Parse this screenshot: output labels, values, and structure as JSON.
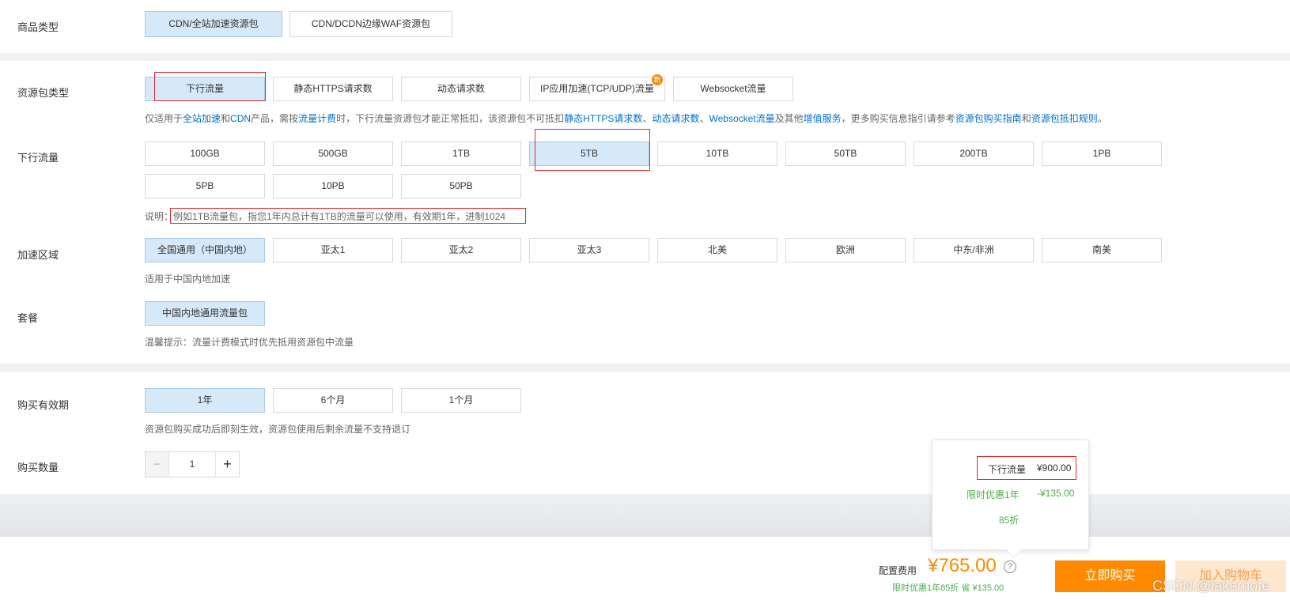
{
  "product_type": {
    "label": "商品类型",
    "options": [
      "CDN/全站加速资源包",
      "CDN/DCDN边缘WAF资源包"
    ]
  },
  "package_type": {
    "label": "资源包类型",
    "options": [
      "下行流量",
      "静态HTTPS请求数",
      "动态请求数",
      "IP应用加速(TCP/UDP)流量",
      "Websocket流量"
    ],
    "new_badge": "新",
    "hint": {
      "p1": "仅适用于",
      "l1": "全站加速",
      "p2": "和",
      "l2": "CDN",
      "p3": "产品，需按",
      "l3": "流量计费",
      "p4": "时，下行流量资源包才能正常抵扣，该资源包不可抵扣",
      "l4": "静态HTTPS请求数",
      "p5": "、",
      "l5": "动态请求数",
      "p6": "、",
      "l6": "Websocket流量",
      "p7": "及其他",
      "l7": "增值服务",
      "p8": "，更多购买信息指引请参考",
      "l8": "资源包购买指南",
      "p9": "和",
      "l9": "资源包抵扣规则",
      "p10": "。"
    }
  },
  "traffic": {
    "label": "下行流量",
    "options": [
      "100GB",
      "500GB",
      "1TB",
      "5TB",
      "10TB",
      "50TB",
      "200TB",
      "1PB",
      "5PB",
      "10PB",
      "50PB"
    ],
    "note_prefix": "说明：",
    "note": "例如1TB流量包，指您1年内总计有1TB的流量可以使用，有效期1年，进制1024"
  },
  "region": {
    "label": "加速区域",
    "options": [
      "全国通用（中国内地）",
      "亚太1",
      "亚太2",
      "亚太3",
      "北美",
      "欧洲",
      "中东/非洲",
      "南美"
    ],
    "hint": "适用于中国内地加速"
  },
  "plan": {
    "label": "套餐",
    "options": [
      "中国内地通用流量包"
    ],
    "hint": "温馨提示：流量计费模式时优先抵用资源包中流量"
  },
  "validity": {
    "label": "购买有效期",
    "options": [
      "1年",
      "6个月",
      "1个月"
    ],
    "hint": "资源包购买成功后即刻生效，资源包使用后剩余流量不支持退订"
  },
  "quantity": {
    "label": "购买数量",
    "minus": "−",
    "value": "1",
    "plus": "+"
  },
  "popover": {
    "item_label": "下行流量",
    "item_price": "¥900.00",
    "discount_label": "限时优惠1年",
    "discount_value": "-¥135.00",
    "discount_rate": "85折"
  },
  "footer": {
    "fee_label": "配置费用",
    "price": "¥765.00",
    "help_icon": "?",
    "discount_note": "限时优惠1年85折 省 ¥135.00",
    "buy_button": "立即购买",
    "cart_button": "加入购物车"
  },
  "watermark": "CSDN @lakernote",
  "colors": {
    "accent_orange": "#ff8a00",
    "selected_bg": "#d6e9f8",
    "link_blue": "#0070cc",
    "discount_green": "#4cae4c",
    "highlight_red": "#e3262c"
  }
}
